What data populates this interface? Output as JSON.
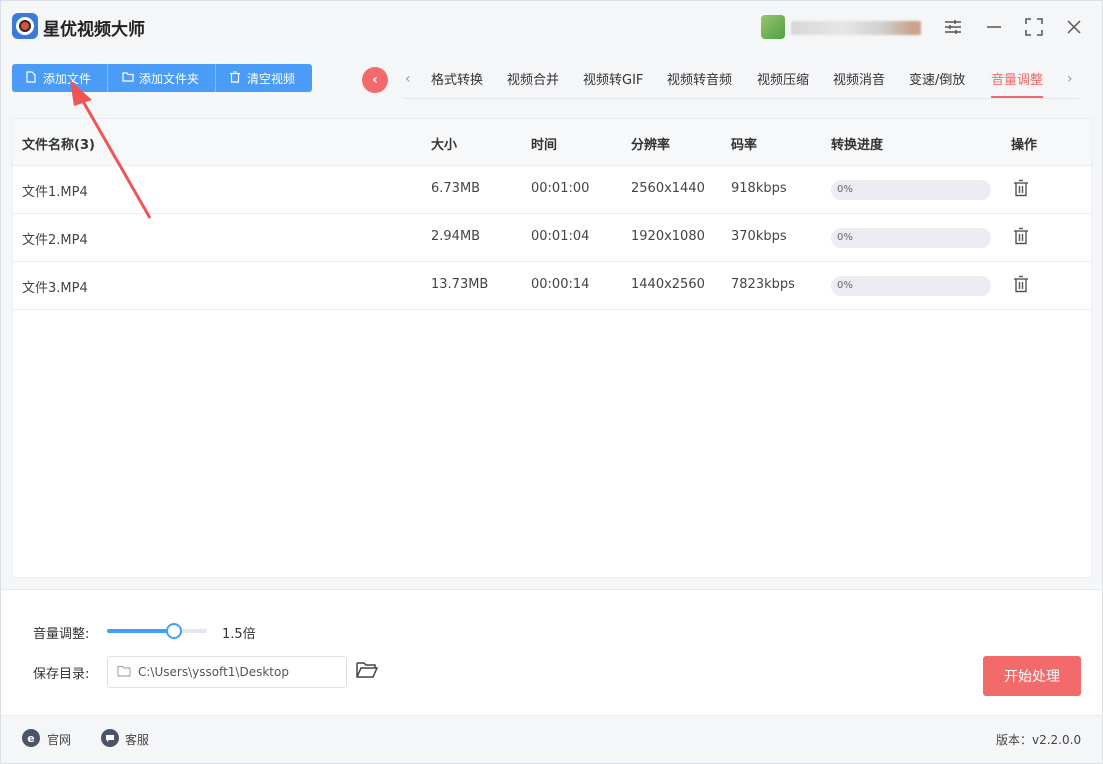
{
  "app": {
    "title": "星优视频大师"
  },
  "toolbar": {
    "add_file": "添加文件",
    "add_folder": "添加文件夹",
    "clear_videos": "清空视频"
  },
  "tabs": [
    "格式转换",
    "视频合并",
    "视频转GIF",
    "视频转音频",
    "视频压缩",
    "视频消音",
    "变速/倒放",
    "音量调整"
  ],
  "active_tab": "音量调整",
  "table": {
    "headers": {
      "name": "文件名称(3)",
      "size": "大小",
      "time": "时间",
      "resolution": "分辨率",
      "bitrate": "码率",
      "progress": "转换进度",
      "action": "操作"
    },
    "rows": [
      {
        "name": "文件1.MP4",
        "size": "6.73MB",
        "time": "00:01:00",
        "resolution": "2560x1440",
        "bitrate": "918kbps",
        "progress": "0%"
      },
      {
        "name": "文件2.MP4",
        "size": "2.94MB",
        "time": "00:01:04",
        "resolution": "1920x1080",
        "bitrate": "370kbps",
        "progress": "0%"
      },
      {
        "name": "文件3.MP4",
        "size": "13.73MB",
        "time": "00:00:14",
        "resolution": "1440x2560",
        "bitrate": "7823kbps",
        "progress": "0%"
      }
    ]
  },
  "volume": {
    "label": "音量调整:",
    "value_text": "1.5倍",
    "slider_fraction": 0.67
  },
  "save_dir": {
    "label": "保存目录:",
    "path": "C:\\Users\\yssoft1\\Desktop"
  },
  "start_button": "开始处理",
  "statusbar": {
    "website": "官网",
    "support": "客服",
    "version": "版本：v2.2.0.0"
  },
  "colors": {
    "primary_blue": "#4a9cf6",
    "accent_red": "#f26a6a",
    "slider_blue": "#409eff"
  }
}
